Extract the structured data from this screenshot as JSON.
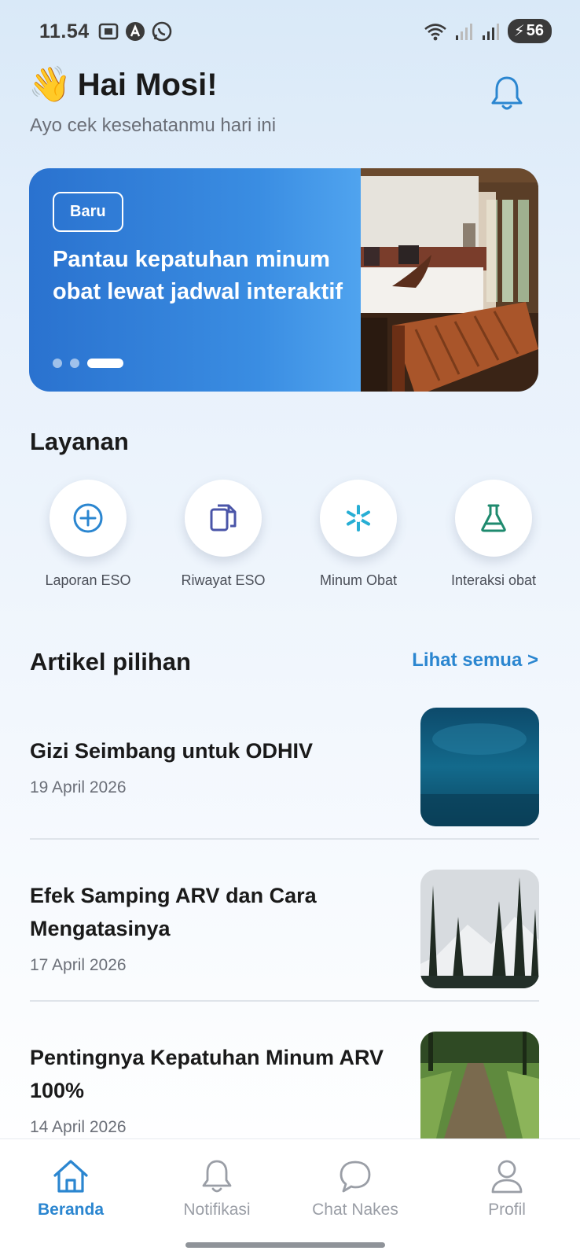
{
  "status_bar": {
    "time": "11.54",
    "battery": "56"
  },
  "header": {
    "wave_emoji": "👋",
    "greeting": "Hai Mosi!",
    "subtitle": "Ayo cek kesehatanmu hari ini",
    "notification_icon": "bell-icon"
  },
  "banner": {
    "badge": "Baru",
    "text": "Pantau kepatuhan minum obat lewat jadwal interaktif",
    "slides": 3,
    "active_slide": 3
  },
  "services": {
    "title": "Layanan",
    "items": [
      {
        "label": "Laporan ESO",
        "icon": "plus-circle-icon"
      },
      {
        "label": "Riwayat ESO",
        "icon": "documents-icon"
      },
      {
        "label": "Minum Obat",
        "icon": "asterisk-icon"
      },
      {
        "label": "Interaksi obat",
        "icon": "flask-icon"
      }
    ]
  },
  "articles": {
    "title": "Artikel pilihan",
    "see_all": "Lihat semua >",
    "items": [
      {
        "title": "Gizi Seimbang untuk ODHIV",
        "date": "19 April 2026"
      },
      {
        "title": "Efek Samping ARV dan Cara Mengatasinya",
        "date": "17 April 2026"
      },
      {
        "title": "Pentingnya Kepatuhan Minum ARV 100%",
        "date": "14 April 2026"
      }
    ]
  },
  "bottom_nav": {
    "items": [
      {
        "label": "Beranda",
        "icon": "home-icon",
        "active": true
      },
      {
        "label": "Notifikasi",
        "icon": "bell-icon"
      },
      {
        "label": "Chat Nakes",
        "icon": "chat-icon"
      },
      {
        "label": "Profil",
        "icon": "user-icon"
      }
    ]
  },
  "colors": {
    "accent": "#2b86d0",
    "banner_start": "#2a72cf",
    "banner_end": "#55a9f2"
  }
}
